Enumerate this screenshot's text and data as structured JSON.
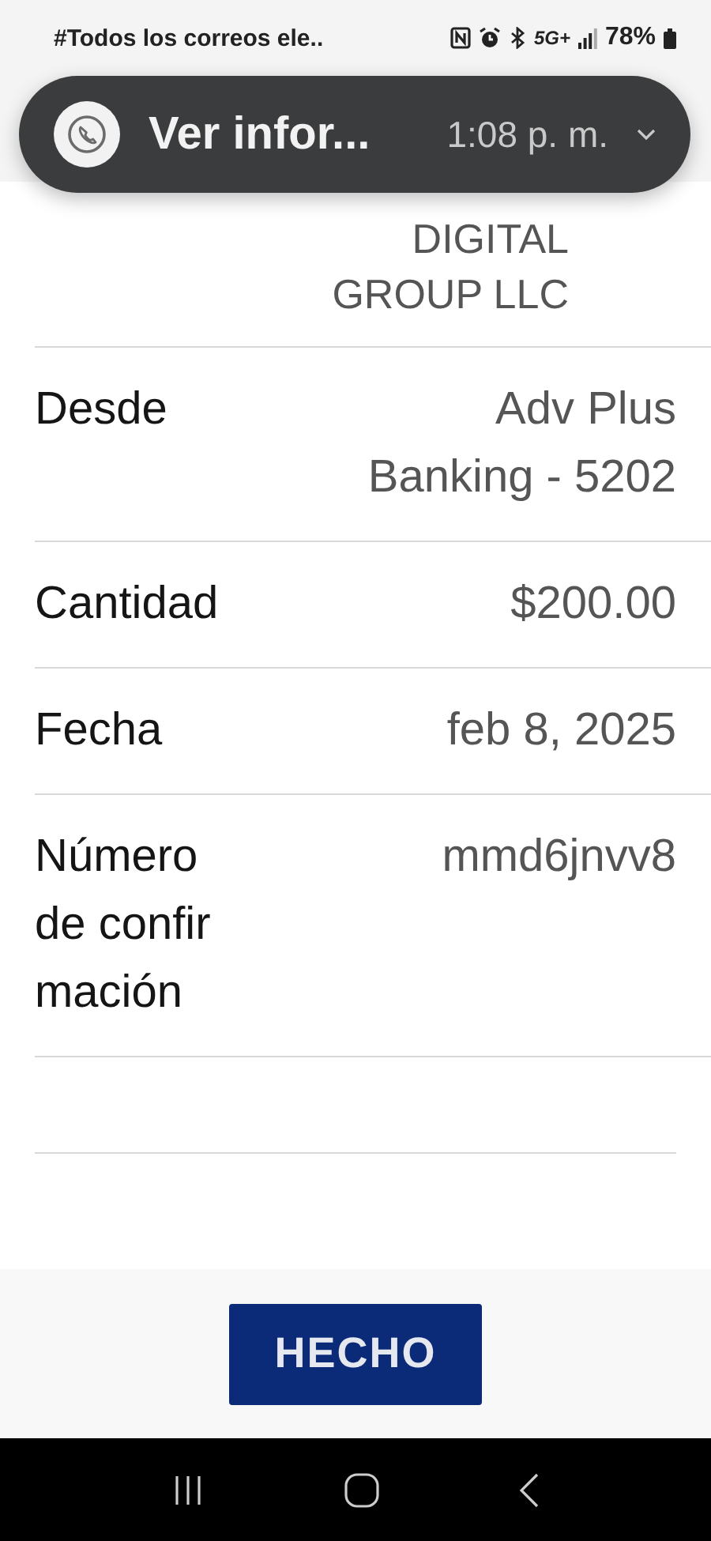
{
  "status_bar": {
    "notification_text": "#Todos los correos ele..",
    "network": "5G+",
    "battery": "78%"
  },
  "notification": {
    "title": "Ver infor...",
    "time": "1:08 p. m."
  },
  "recipient_lines": [
    "DIGITAL",
    "GROUP LLC"
  ],
  "details": [
    {
      "label_lines": [
        "Desde"
      ],
      "value_lines": [
        "Adv Plus",
        "Banking - 5202"
      ]
    },
    {
      "label_lines": [
        "Cantidad"
      ],
      "value_lines": [
        "$200.00"
      ]
    },
    {
      "label_lines": [
        "Fecha"
      ],
      "value_lines": [
        "feb 8, 2025"
      ]
    },
    {
      "label_lines": [
        "Número",
        "de confir",
        "mación"
      ],
      "value_lines": [
        "mmd6jnvv8"
      ]
    }
  ],
  "done_button": "HECHO"
}
